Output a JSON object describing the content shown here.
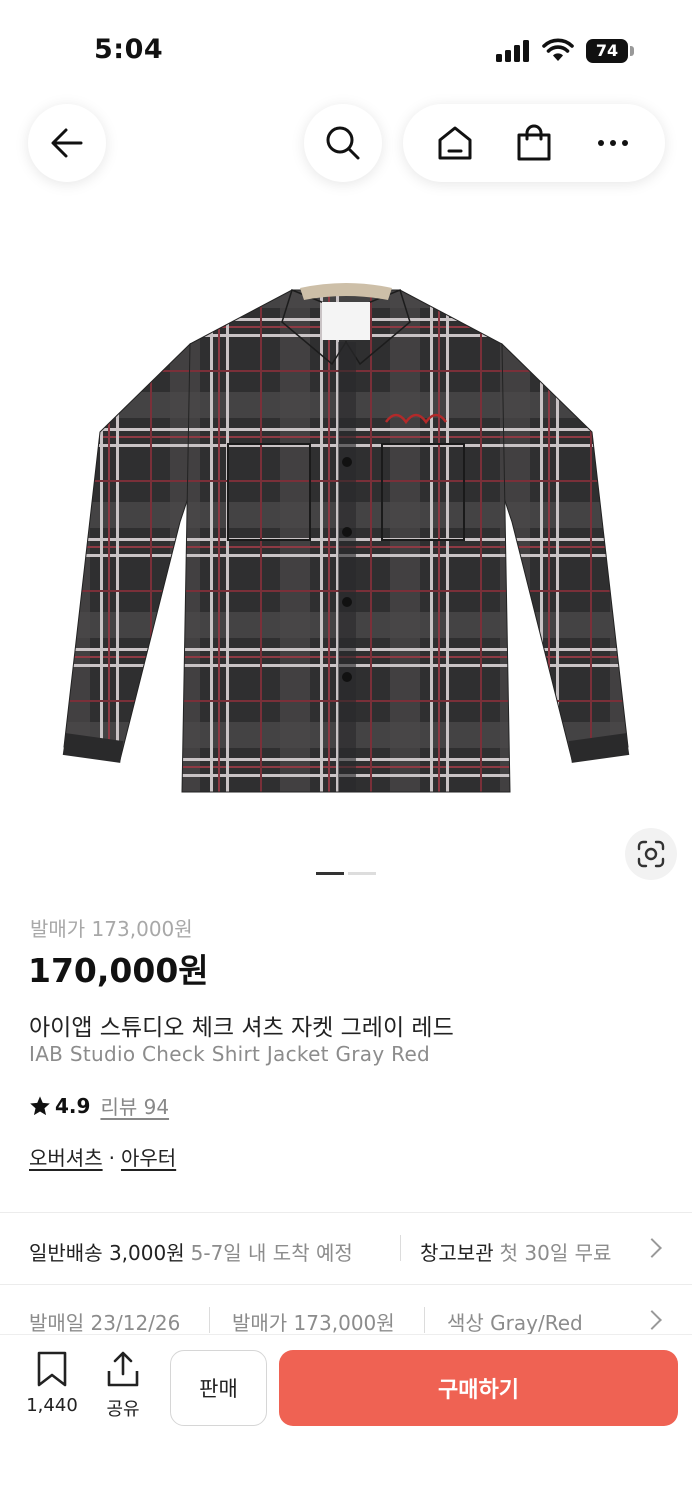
{
  "status_bar": {
    "time": "5:04",
    "battery": "74"
  },
  "nav": {
    "back_icon": "arrow-left-icon",
    "search_icon": "search-icon",
    "home_icon": "home-icon",
    "bag_icon": "shopping-bag-icon",
    "more_icon": "more-horizontal-icon"
  },
  "gallery": {
    "image_description_icon": "plaid-shirt-jacket",
    "current_slide": 1,
    "total_slides": 2
  },
  "product": {
    "release_price_label": "발매가 173,000원",
    "price": "170,000원",
    "name_ko": "아이앱 스튜디오 체크 셔츠 자켓 그레이 레드",
    "name_en": "IAB Studio Check Shirt Jacket Gray Red",
    "rating": "4.9",
    "reviews": "리뷰 94",
    "category_1": "오버셔츠",
    "category_sep": "·",
    "category_2": "아우터"
  },
  "shipping": {
    "standard_label": "일반배송 3,000원",
    "standard_eta": "5-7일 내 도착 예정",
    "storage_label": "창고보관",
    "storage_note": "첫 30일 무료"
  },
  "details": {
    "release_date": "발매일 23/12/26",
    "release_price": "발매가 173,000원",
    "color": "색상 Gray/Red"
  },
  "bottom_bar": {
    "bookmark_count": "1,440",
    "share_label": "공유",
    "sell_label": "판매",
    "buy_label": "구매하기"
  },
  "colors": {
    "accent": "#ef6253",
    "text": "#222222",
    "muted": "#8c8c8c"
  }
}
